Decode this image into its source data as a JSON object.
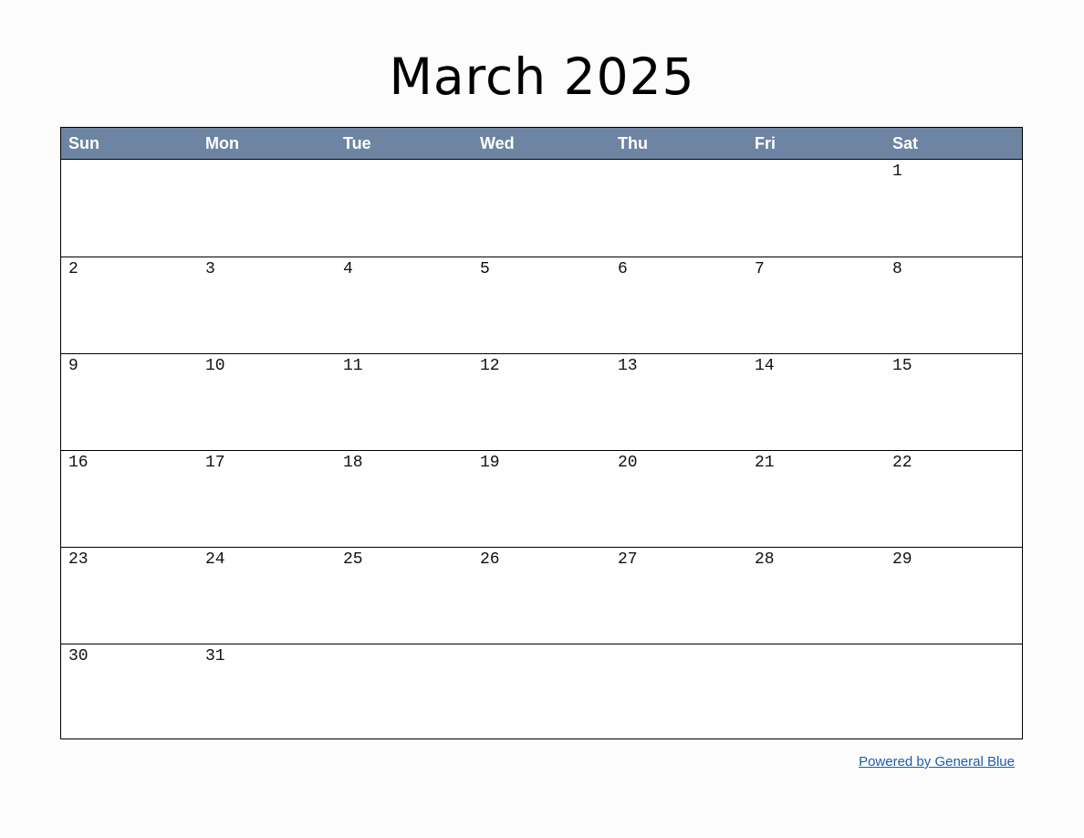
{
  "title": "March 2025",
  "weekdays": [
    "Sun",
    "Mon",
    "Tue",
    "Wed",
    "Thu",
    "Fri",
    "Sat"
  ],
  "weeks": [
    [
      "",
      "",
      "",
      "",
      "",
      "",
      "1"
    ],
    [
      "2",
      "3",
      "4",
      "5",
      "6",
      "7",
      "8"
    ],
    [
      "9",
      "10",
      "11",
      "12",
      "13",
      "14",
      "15"
    ],
    [
      "16",
      "17",
      "18",
      "19",
      "20",
      "21",
      "22"
    ],
    [
      "23",
      "24",
      "25",
      "26",
      "27",
      "28",
      "29"
    ],
    [
      "30",
      "31",
      "",
      "",
      "",
      "",
      ""
    ]
  ],
  "footer_link": "Powered by General Blue",
  "colors": {
    "header_bg": "#6d84a2",
    "link": "#1a5fb0"
  }
}
